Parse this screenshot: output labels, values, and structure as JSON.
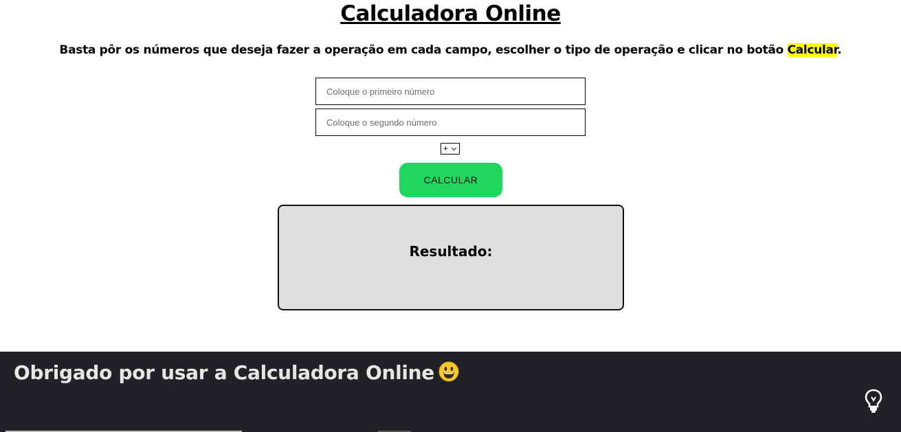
{
  "header": {
    "title": "Calculadora Online",
    "instructions_before": "Basta pôr os números que deseja fazer a operação em cada campo, escolher o tipo de operação e clicar no botão ",
    "instructions_highlight": "Calcular",
    "instructions_after": "."
  },
  "form": {
    "first_placeholder": "Coloque o primeiro número",
    "first_value": "",
    "second_placeholder": "Coloque o segundo número",
    "second_value": "",
    "operation_selected": "+",
    "calculate_label": "CALCULAR"
  },
  "result": {
    "label": "Resultado:"
  },
  "footer": {
    "message": "Obrigado por usar a Calculadora Online",
    "emoji_icon": "grinning-face-icon",
    "bulb_icon": "lightbulb-icon"
  },
  "colors": {
    "button_green": "#1fd65f",
    "highlight_yellow": "#ffff00",
    "result_bg": "#dfdddd",
    "footer_bg": "#212226"
  }
}
